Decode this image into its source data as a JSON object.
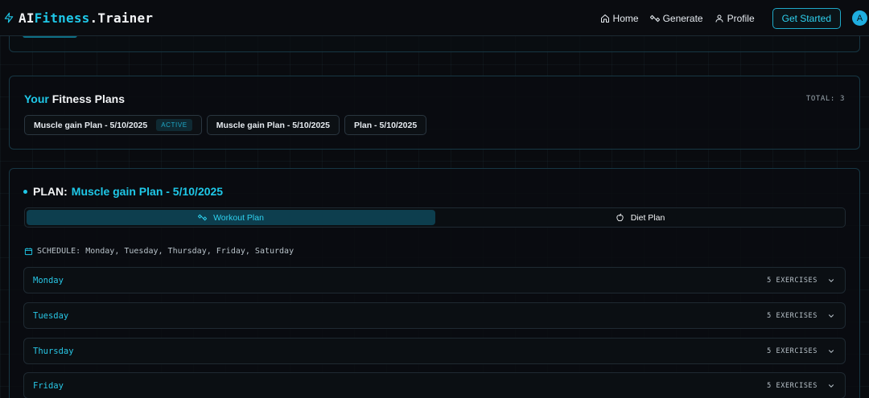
{
  "header": {
    "brand_white_1": "AI",
    "brand_cyan": "Fitness",
    "brand_white_2": ".Trainer",
    "nav": [
      {
        "label": "Home",
        "icon": "home-icon"
      },
      {
        "label": "Generate",
        "icon": "dumbbell-icon"
      },
      {
        "label": "Profile",
        "icon": "user-icon"
      }
    ],
    "cta_label": "Get Started",
    "avatar_letter": "A"
  },
  "plans": {
    "title_cyan": "Your",
    "title_white": "Fitness Plans",
    "total_label": "TOTAL: 3",
    "items": [
      {
        "label": "Muscle gain Plan - 5/10/2025",
        "badge": "ACTIVE"
      },
      {
        "label": "Muscle gain Plan - 5/10/2025"
      },
      {
        "label": "Plan - 5/10/2025"
      }
    ]
  },
  "detail": {
    "prefix": "PLAN:",
    "plan_name": "Muscle gain Plan - 5/10/2025",
    "tabs": {
      "workout": "Workout Plan",
      "diet": "Diet Plan",
      "active": "workout"
    },
    "schedule_label": "SCHEDULE: Monday, Tuesday, Thursday, Friday, Saturday",
    "days": [
      {
        "name": "Monday",
        "count": "5 EXERCISES"
      },
      {
        "name": "Tuesday",
        "count": "5 EXERCISES"
      },
      {
        "name": "Thursday",
        "count": "5 EXERCISES"
      },
      {
        "name": "Friday",
        "count": "5 EXERCISES"
      }
    ]
  },
  "colors": {
    "accent": "#1fc8e8",
    "background": "#090b0f",
    "border": "#173744"
  }
}
